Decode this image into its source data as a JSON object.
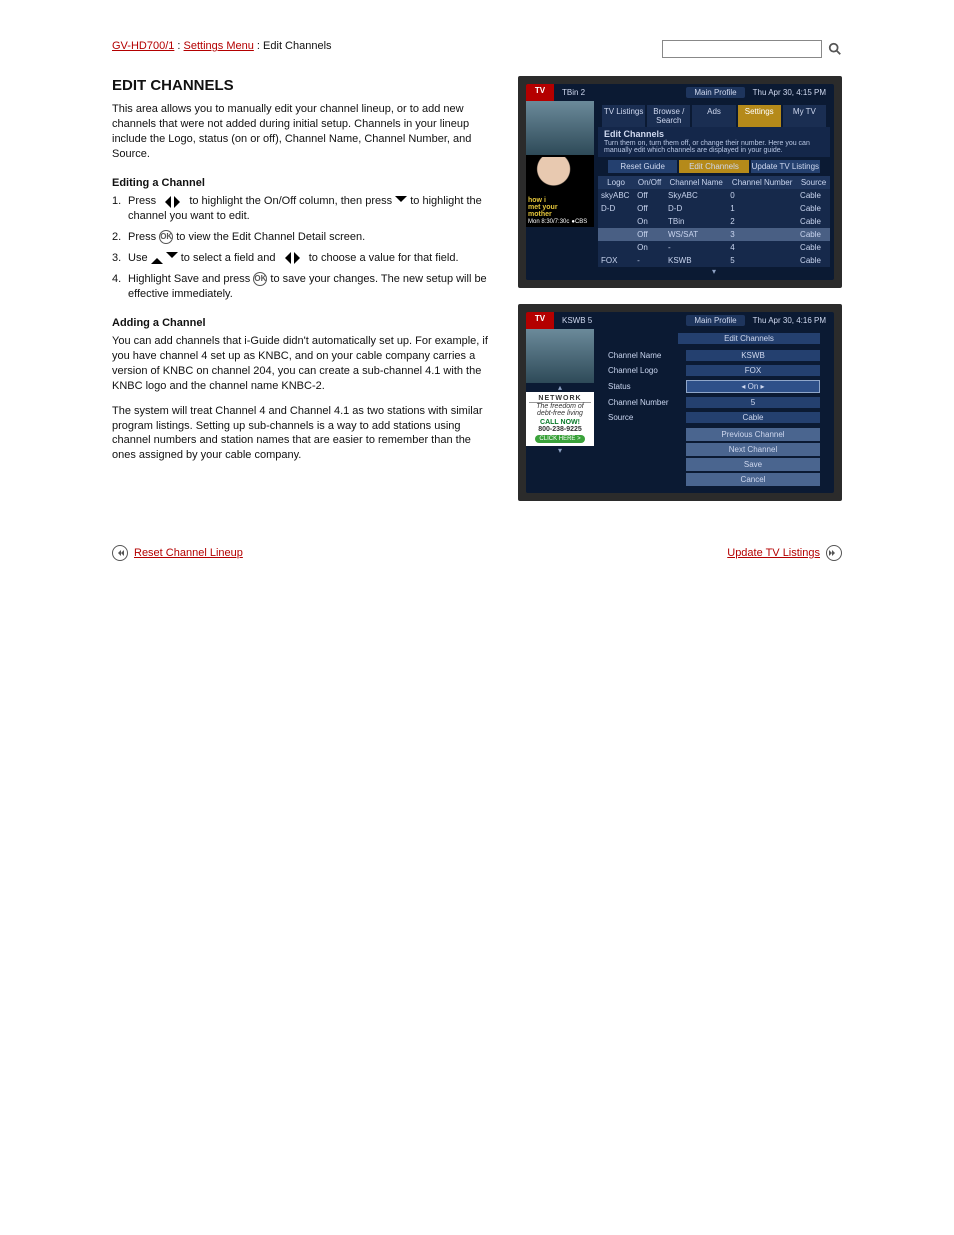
{
  "breadcrumb": {
    "a": "GV-HD700/1",
    "sep": " : ",
    "b": "Settings Menu",
    "tail": " : Edit Channels"
  },
  "search": {
    "placeholder": ""
  },
  "title": "EDIT CHANNELS",
  "intro": "This area allows you to manually edit your channel lineup, or to add new channels that were not added during initial setup. Channels in your lineup include the Logo, status (on or off), Channel Name, Channel Number, and Source.",
  "edit_heading": "Editing a Channel",
  "step1a": "Press ",
  "step1b": " to highlight the On/Off column, then press ",
  "step1c": " to highlight the channel you want to edit.",
  "step2a": "Press ",
  "step2b": " to view the Edit Channel Detail screen.",
  "step3a": "Use ",
  "step3b": " to select a field and ",
  "step3c": " to choose a value for that field.",
  "step4a": "Highlight Save and press ",
  "step4b": " to save your changes. The new setup will be effective immediately.",
  "add_heading": "Adding a Channel",
  "add_p1": "You can add channels that i-Guide didn't automatically set up. For example, if you have channel 4 set up as KNBC, and on your cable company carries a version of KNBC on channel 204, you can create a sub-channel 4.1 with the KNBC logo and the channel name KNBC-2.",
  "add_p2": "The system will treat Channel 4 and Channel 4.1 as two stations with similar program listings. Setting up sub-channels is a way to add stations using channel numbers and station names that are easier to remember than the ones assigned by your cable company.",
  "prev_link": "Reset Channel Lineup",
  "next_link": "Update TV Listings",
  "shot1": {
    "brand": "TV",
    "chan": "TBin 2",
    "profile": "Main Profile",
    "time": "Thu Apr 30, 4:15 PM",
    "tabs": [
      "TV Listings",
      "Browse / Search",
      "Ads",
      "Settings",
      "My TV"
    ],
    "subtabs": [
      "Reset Guide",
      "Edit Channels",
      "Update TV Listings"
    ],
    "heading": "Edit Channels",
    "sub": "Turn them on, turn them off, or change their number. Here you can manually edit which channels are displayed in your guide.",
    "cols": [
      "Logo",
      "On/Off",
      "Channel Name",
      "Channel Number",
      "Source"
    ],
    "rows": [
      [
        "skyABC",
        "Off",
        "SkyABC",
        "0",
        "Cable"
      ],
      [
        "D-D",
        "Off",
        "D-D",
        "1",
        "Cable"
      ],
      [
        "",
        "On",
        "TBin",
        "2",
        "Cable"
      ],
      [
        "",
        "Off",
        "WS/SAT",
        "3",
        "Cable"
      ],
      [
        "",
        "On",
        "-",
        "4",
        "Cable"
      ],
      [
        "FOX",
        "-",
        "KSWB",
        "5",
        "Cable"
      ]
    ],
    "himym": {
      "l1": "how i",
      "l2": "met your",
      "l3": "mother",
      "sched": "Mon 8:30/7:30c",
      "net": "CBS"
    }
  },
  "shot2": {
    "brand": "TV",
    "chan": "KSWB 5",
    "profile": "Main Profile",
    "time": "Thu Apr 30, 4:16 PM",
    "title": "Edit Channels",
    "fields": {
      "name_lbl": "Channel Name",
      "name_val": "KSWB",
      "logo_lbl": "Channel Logo",
      "logo_val": "FOX",
      "status_lbl": "Status",
      "status_val": "On",
      "num_lbl": "Channel Number",
      "num_val": "5",
      "src_lbl": "Source",
      "src_val": "Cable"
    },
    "buttons": [
      "Previous Channel",
      "Next Channel",
      "Save",
      "Cancel"
    ],
    "ad": {
      "brand": "NETWORK",
      "tag1": "The freedom of",
      "tag2": "debt-free living",
      "call": "CALL NOW!",
      "phone": "800-238-9225",
      "cta": "CLICK HERE >"
    }
  }
}
